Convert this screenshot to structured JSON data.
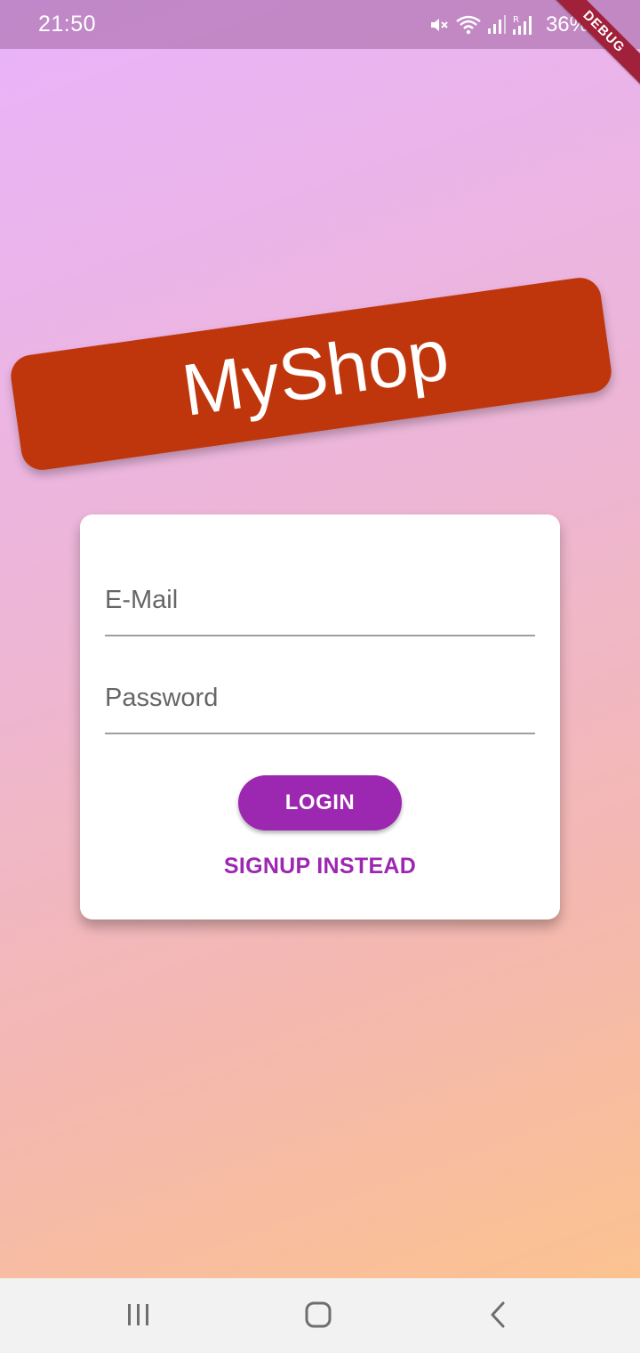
{
  "status_bar": {
    "time": "21:50",
    "battery": "36%",
    "icons": [
      "mute-icon",
      "wifi-icon",
      "signal-icon",
      "signal-r-icon"
    ]
  },
  "debug_banner": "DEBUG",
  "app": {
    "title": "MyShop"
  },
  "auth_form": {
    "email_placeholder": "E-Mail",
    "password_placeholder": "Password",
    "login_label": "LOGIN",
    "signup_label": "SIGNUP INSTEAD"
  },
  "nav_bar": {
    "icons": [
      "recents-icon",
      "home-icon",
      "back-icon"
    ]
  },
  "colors": {
    "title_banner": "#bf360c",
    "primary": "#9c27b0",
    "gradient_start": "#e9b3fb",
    "gradient_end": "#fdc48a"
  }
}
